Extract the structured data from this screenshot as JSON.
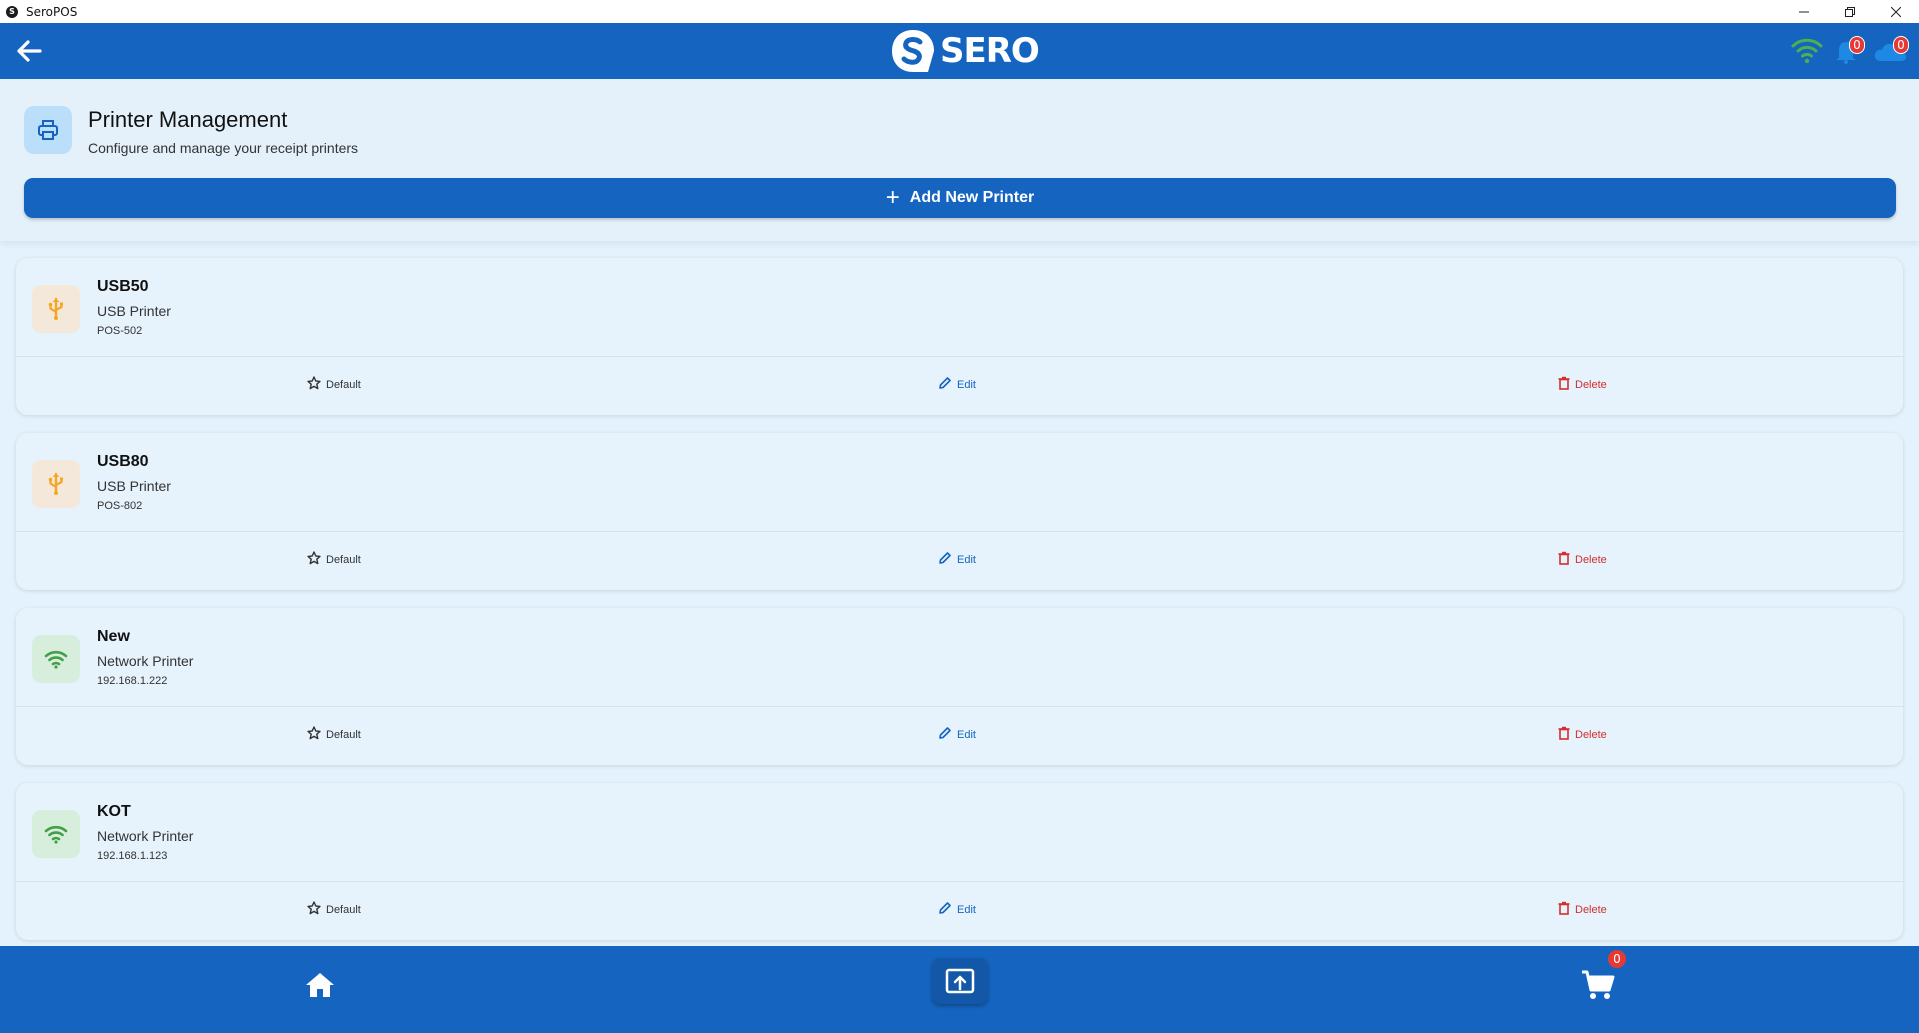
{
  "window": {
    "title": "SeroPOS",
    "controls": [
      "minimize-icon",
      "restore-icon",
      "close-icon"
    ]
  },
  "header": {
    "brand": "SERO",
    "notification_count": "0",
    "sync_count": "0",
    "icons": [
      "back-arrow-icon",
      "wifi-icon",
      "bell-icon",
      "cloud-icon"
    ]
  },
  "page": {
    "title": "Printer Management",
    "subtitle": "Configure and manage your receipt printers",
    "icon": "printer-icon",
    "add_button_label": "Add New Printer"
  },
  "printers": [
    {
      "name": "USB50",
      "type": "USB Printer",
      "detail": "POS-502",
      "kind": "usb"
    },
    {
      "name": "USB80",
      "type": "USB Printer",
      "detail": "POS-802",
      "kind": "usb"
    },
    {
      "name": "New",
      "type": "Network Printer",
      "detail": "192.168.1.222",
      "kind": "network"
    },
    {
      "name": "KOT",
      "type": "Network Printer",
      "detail": "192.168.1.123",
      "kind": "network"
    }
  ],
  "actions": {
    "default_label": "Default",
    "edit_label": "Edit",
    "delete_label": "Delete"
  },
  "bottom_nav": {
    "cart_count": "0",
    "icons": [
      "home-icon",
      "upload-screen-icon",
      "cart-icon"
    ]
  },
  "colors": {
    "primary": "#1565c0",
    "background": "#e3f2fd",
    "delete": "#d32f2f",
    "usb_icon": "#f5a623",
    "network_icon": "#43a047",
    "wifi_status": "#4caf50"
  }
}
